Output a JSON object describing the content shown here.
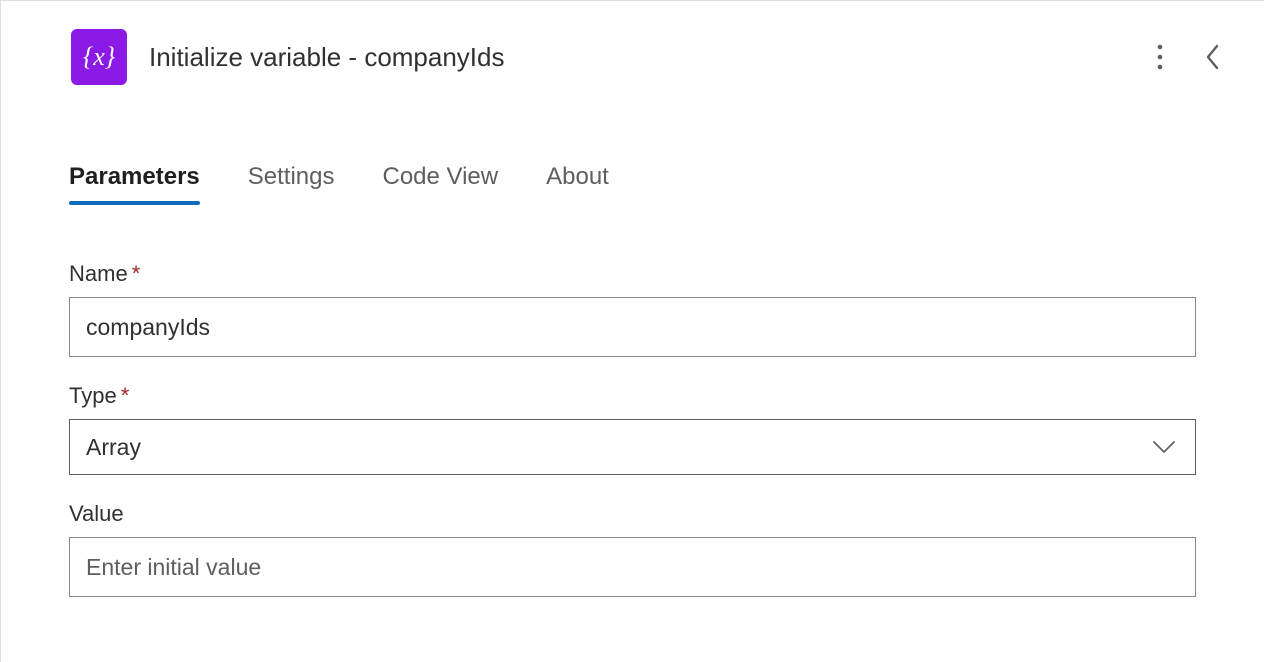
{
  "header": {
    "icon_text": "{x}",
    "title": "Initialize variable - companyIds"
  },
  "tabs": {
    "parameters": "Parameters",
    "settings": "Settings",
    "codeview": "Code View",
    "about": "About"
  },
  "fields": {
    "name": {
      "label": "Name",
      "required": "*",
      "value": "companyIds"
    },
    "type": {
      "label": "Type",
      "required": "*",
      "value": "Array"
    },
    "value": {
      "label": "Value",
      "placeholder": "Enter initial value",
      "value": ""
    }
  }
}
